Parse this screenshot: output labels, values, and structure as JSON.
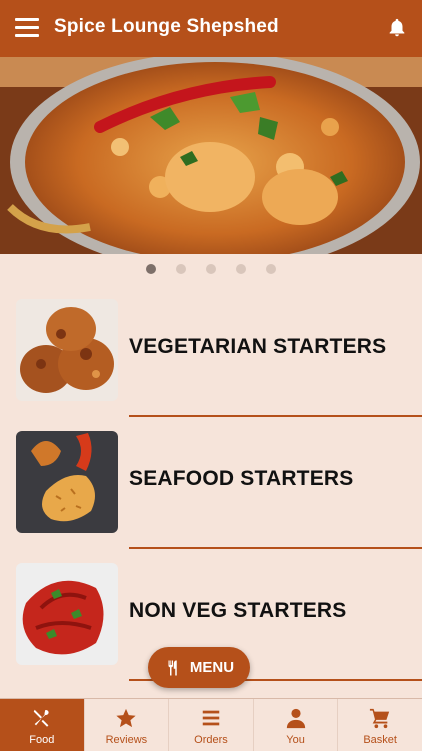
{
  "header": {
    "title": "Spice Lounge Shepshed"
  },
  "carousel": {
    "dots": 5,
    "active_index": 0
  },
  "categories": [
    {
      "label": "VEGETARIAN STARTERS"
    },
    {
      "label": "SEAFOOD STARTERS"
    },
    {
      "label": "NON VEG STARTERS"
    }
  ],
  "fab": {
    "label": "MENU"
  },
  "tabs": [
    {
      "label": "Food",
      "icon": "fork-spoon-icon",
      "active": true
    },
    {
      "label": "Reviews",
      "icon": "star-icon",
      "active": false
    },
    {
      "label": "Orders",
      "icon": "list-icon",
      "active": false
    },
    {
      "label": "You",
      "icon": "person-icon",
      "active": false
    },
    {
      "label": "Basket",
      "icon": "cart-icon",
      "active": false
    }
  ],
  "colors": {
    "brand": "#b5501a",
    "background": "#f6e4da"
  }
}
